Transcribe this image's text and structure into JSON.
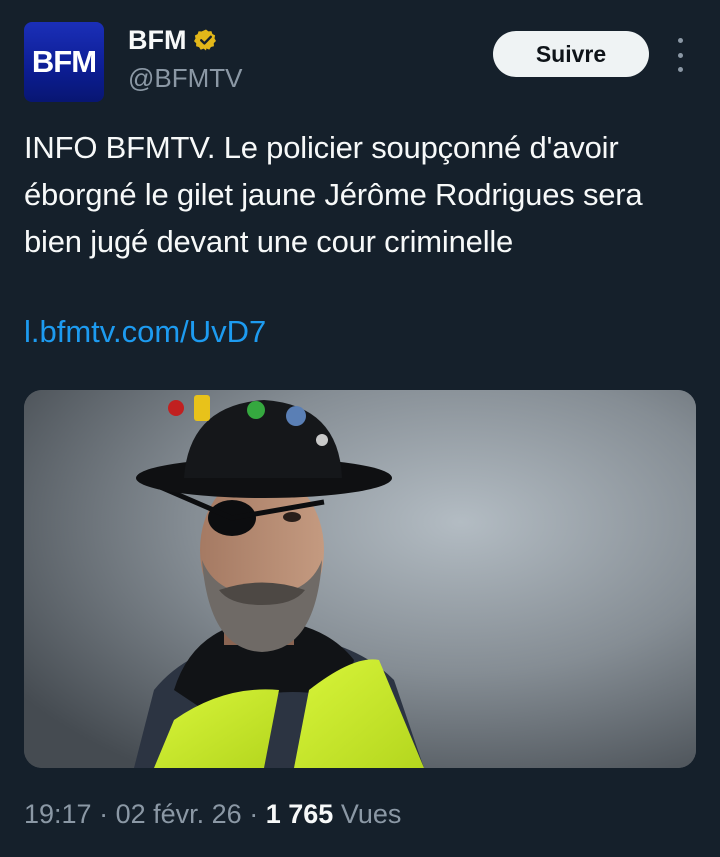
{
  "account": {
    "display_name": "BFM",
    "handle": "@BFMTV",
    "avatar_text": "BFM",
    "verified_color": "#e2b719"
  },
  "actions": {
    "follow_label": "Suivre"
  },
  "tweet": {
    "text": "INFO BFMTV. Le policier soupçonné d'avoir éborgné le gilet jaune Jérôme Rodrigues sera bien jugé devant une cour criminelle",
    "link": "l.bfmtv.com/UvD7"
  },
  "meta": {
    "time": "19:17",
    "sep1": "·",
    "date": "02 févr. 26",
    "sep2": "·",
    "views_count": "1 765",
    "views_label": "Vues"
  },
  "colors": {
    "background": "#15202b",
    "link": "#1d9bf0",
    "secondary_text": "#8b98a5"
  }
}
